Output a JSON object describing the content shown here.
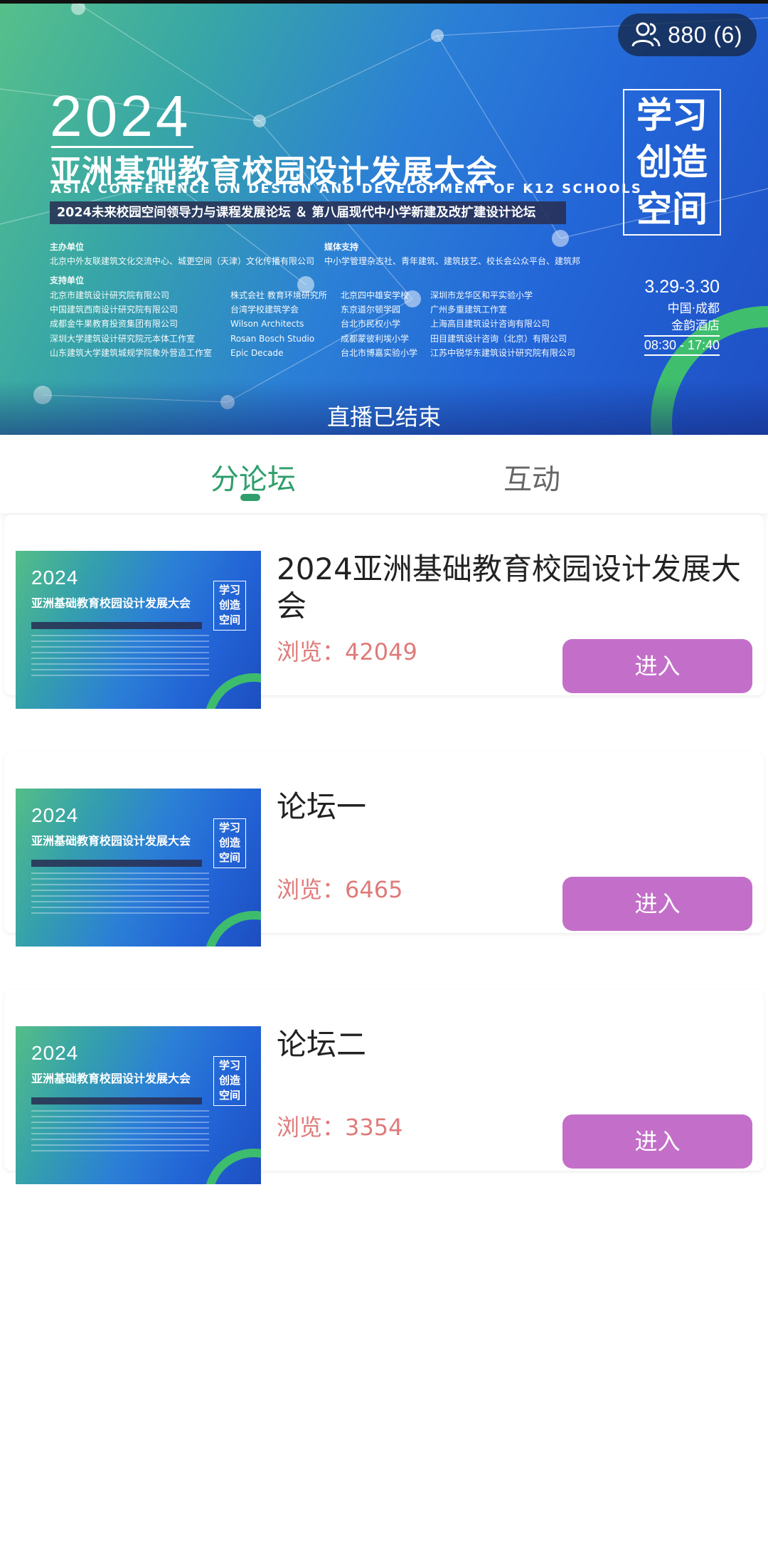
{
  "banner": {
    "viewer_count": "880 (6)",
    "year": "2024",
    "title": "亚洲基础教育校园设计发展大会",
    "title_en": "ASIA CONFERENCE ON DESIGN AND DEVELOPMENT OF K12 SCHOOLS",
    "forum_line": "2024未来校园空间领导力与课程发展论坛 ＆ 第八届现代中小学新建及改扩建设计论坛",
    "host_label": "主办单位",
    "host": "北京中外友联建筑文化交流中心、城更空间（天津）文化传播有限公司",
    "media_label": "媒体支持",
    "media": "中小学管理杂志社、青年建筑、建筑技艺、校长会公众平台、建筑邦",
    "support_label": "支持单位",
    "support_col1": [
      "北京市建筑设计研究院有限公司",
      "中国建筑西南设计研究院有限公司",
      "成都金牛果教育投资集团有限公司",
      "深圳大学建筑设计研究院元本体工作室",
      "山东建筑大学建筑城规学院象外营造工作室"
    ],
    "support_col2": [
      "株式会社 教育环境研究所",
      "台湾学校建筑学会",
      "Wilson Architects",
      "Rosan Bosch Studio",
      "Epic Decade"
    ],
    "support_col3": [
      "北京四中雄安学校",
      "东京道尔顿学园",
      "台北市民权小学",
      "成都蒙彼利埃小学",
      "台北市博嘉实验小学"
    ],
    "support_col4": [
      "深圳市龙华区和平实验小学",
      "广州多重建筑工作室",
      "上海高目建筑设计咨询有限公司",
      "田目建筑设计咨询（北京）有限公司",
      "江苏中锐华东建筑设计研究院有限公司"
    ],
    "motto_lines": [
      "学习",
      "创造",
      "空间"
    ],
    "dates": "3.29-3.30",
    "place_city": "中国·成都",
    "place_venue": "金韵酒店",
    "hours": "08:30 - 17:40",
    "status": "直播已结束"
  },
  "tabs": [
    {
      "label": "分论坛",
      "active": true
    },
    {
      "label": "互动",
      "active": false
    }
  ],
  "cards": [
    {
      "title": "2024亚洲基础教育校园设计发展大会",
      "views": "浏览：42049",
      "button": "进入"
    },
    {
      "title": "论坛一",
      "views": "浏览：6465",
      "button": "进入"
    },
    {
      "title": "论坛二",
      "views": "浏览：3354",
      "button": "进入"
    }
  ],
  "thumbnail": {
    "year": "2024",
    "title": "亚洲基础教育校园设计发展大会",
    "motto": "学习创造空间"
  },
  "colors": {
    "accent_green": "#2f9e6c",
    "button_purple": "#c36fc9",
    "views_red": "#e07a7a"
  }
}
